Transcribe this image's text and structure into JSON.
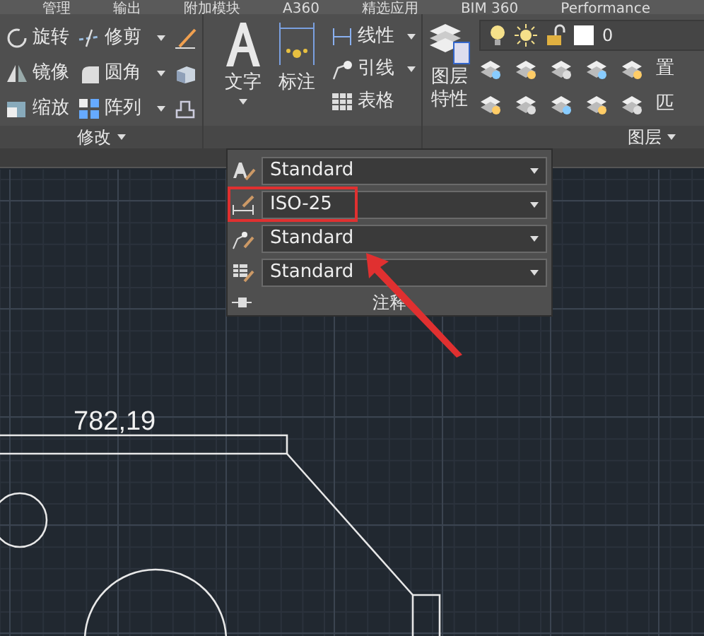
{
  "ribbon_tabs": [
    "管理",
    "输出",
    "附加模块",
    "A360",
    "精选应用",
    "BIM 360",
    "Performance"
  ],
  "modify_panel": {
    "tools": [
      {
        "label": "旋转",
        "dropdown": false
      },
      {
        "label": "镜像",
        "dropdown": false
      },
      {
        "label": "缩放",
        "dropdown": false
      },
      {
        "label": "修剪",
        "dropdown": true
      },
      {
        "label": "圆角",
        "dropdown": true
      },
      {
        "label": "阵列",
        "dropdown": true
      }
    ],
    "label": "修改"
  },
  "annotation_panel": {
    "big_tools": [
      {
        "label": "文字",
        "dropdown": true
      },
      {
        "label": "标注",
        "dropdown": false
      }
    ],
    "tools": [
      {
        "label": "线性",
        "dropdown": true
      },
      {
        "label": "引线",
        "dropdown": true
      },
      {
        "label": "表格",
        "dropdown": false
      }
    ],
    "styles": [
      {
        "kind": "text",
        "value": "Standard",
        "highlighted": false
      },
      {
        "kind": "dimension",
        "value": "ISO-25",
        "highlighted": true
      },
      {
        "kind": "leader",
        "value": "Standard",
        "highlighted": false
      },
      {
        "kind": "table",
        "value": "Standard",
        "highlighted": false
      }
    ],
    "label": "注释"
  },
  "layers_panel": {
    "big_tool": "图层特性",
    "layer": "0",
    "row_labels": [
      "置",
      "匹"
    ],
    "label": "图层"
  },
  "drawing": {
    "dimension": "782,19"
  }
}
